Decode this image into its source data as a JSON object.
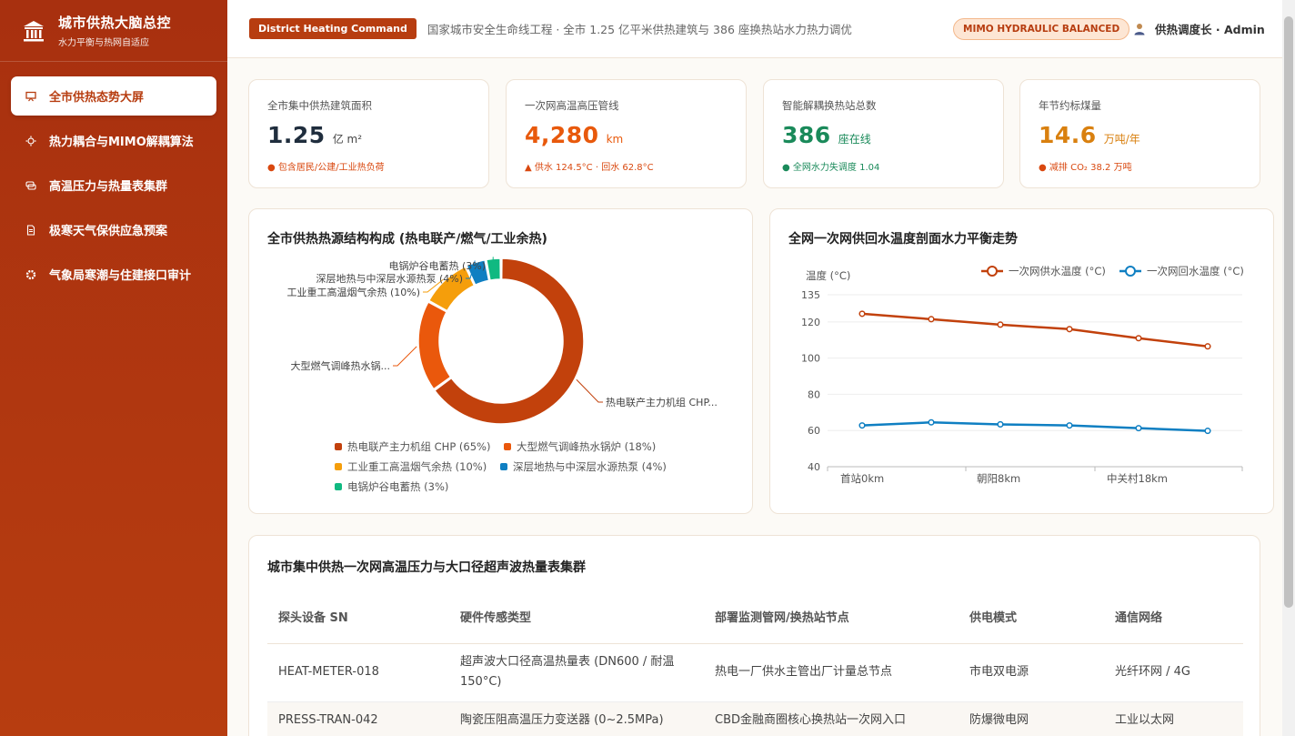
{
  "sidebar": {
    "title": "城市供热大脑总控",
    "subtitle": "水力平衡与热网自适应",
    "items": [
      {
        "label": "全市供热态势大屏",
        "active": true
      },
      {
        "label": "热力耦合与MIMO解耦算法"
      },
      {
        "label": "高温压力与热量表集群"
      },
      {
        "label": "极寒天气保供应急预案"
      },
      {
        "label": "气象局寒潮与住建接口审计"
      }
    ]
  },
  "header": {
    "tag": "District Heating Command",
    "description": "国家城市安全生命线工程 · 全市 1.25 亿平米供热建筑与 386 座换热站水力热力调优",
    "mimo_badge": "MIMO HYDRAULIC BALANCED",
    "user": "供热调度长 · Admin"
  },
  "stats": [
    {
      "label": "全市集中供热建筑面积",
      "value": "1.25",
      "unit": "亿 m²",
      "note": "● 包含居民/公建/工业热负荷",
      "color": "#1f2d3d",
      "note_color": "#d9480f"
    },
    {
      "label": "一次网高温高压管线",
      "value": "4,280",
      "unit": "km",
      "note": "▲ 供水 124.5°C · 回水 62.8°C",
      "color": "#e8590c",
      "note_color": "#d9480f"
    },
    {
      "label": "智能解耦换热站总数",
      "value": "386",
      "unit": "座在线",
      "note": "● 全网水力失调度 1.04",
      "color": "#1a8a5a",
      "note_color": "#1a8a5a"
    },
    {
      "label": "年节约标煤量",
      "value": "14.6",
      "unit": "万吨/年",
      "note": "● 减排 CO₂ 38.2 万吨",
      "color": "#d9800f",
      "note_color": "#d9480f"
    }
  ],
  "donut_panel": {
    "title": "全市供热热源结构构成 (热电联产/燃气/工业余热)"
  },
  "line_panel": {
    "title": "全网一次网供回水温度剖面水力平衡走势"
  },
  "chart_data": [
    {
      "type": "pie",
      "categories": [
        "热电联产主力机组 CHP",
        "大型燃气调峰热水锅炉",
        "工业重工高温烟气余热",
        "深层地热与中深层水源热泵",
        "电锅炉谷电蓄热"
      ],
      "values": [
        65,
        18,
        10,
        4,
        3
      ],
      "legend": [
        "热电联产主力机组 CHP (65%)",
        "大型燃气调峰热水锅炉 (18%)",
        "工业重工高温烟气余热 (10%)",
        "深层地热与中深层水源热泵 (4%)",
        "电锅炉谷电蓄热 (3%)"
      ],
      "slice_labels": [
        "热电联产主力机组 CHP...",
        "大型燃气调峰热水锅...",
        "工业重工高温烟气余热 (10%)",
        "深层地热与中深层水源热泵 (4%)",
        "电锅炉谷电蓄热 (3%)"
      ],
      "colors": [
        "#c2410c",
        "#ea580c",
        "#f59e0b",
        "#0f7fc2",
        "#10b981"
      ],
      "legend_position": "bottom"
    },
    {
      "type": "line",
      "ylabel": "温度 (°C)",
      "ylim": [
        40,
        135
      ],
      "yticks": [
        40,
        60,
        80,
        100,
        120,
        135
      ],
      "xtick_labels": [
        "首站0km",
        "朝阳8km",
        "中关村18km"
      ],
      "series": [
        {
          "name": "一次网供水温度 (°C)",
          "color": "#c2410c",
          "values": [
            124.5,
            121.5,
            118.5,
            116,
            111,
            106.5
          ]
        },
        {
          "name": "一次网回水温度 (°C)",
          "color": "#0f7fc2",
          "values": [
            62.8,
            64.5,
            63.4,
            62.8,
            61.3,
            59.8
          ]
        }
      ],
      "legend_position": "top-right",
      "grid": true
    }
  ],
  "table": {
    "title": "城市集中供热一次网高温压力与大口径超声波热量表集群",
    "headers": [
      "探头设备 SN",
      "硬件传感类型",
      "部署监测管网/换热站节点",
      "供电模式",
      "通信网络"
    ],
    "rows": [
      [
        "HEAT-METER-018",
        "超声波大口径高温热量表 (DN600 / 耐温 150°C)",
        "热电一厂供水主管出厂计量总节点",
        "市电双电源",
        "光纤环网 / 4G"
      ],
      [
        "PRESS-TRAN-042",
        "陶瓷压阻高温压力变送器 (0~2.5MPa)",
        "CBD金融商圈核心换热站一次网入口",
        "防爆微电网",
        "工业以太网"
      ]
    ]
  }
}
